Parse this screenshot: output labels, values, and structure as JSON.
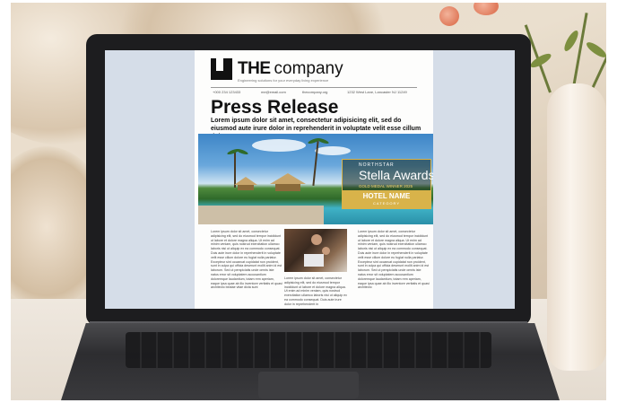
{
  "doc": {
    "logo_the": "THE",
    "logo_company": "company",
    "tagline": "Engineering solutions for your everyday living experience",
    "contact": [
      "+000 234 123433",
      "me@email.com",
      "thecompany.org",
      "1232 West Lane, Lancaster NJ 11249"
    ],
    "headline": "Press Release",
    "lead": "Lorem ipsum dolor sit amet, consectetur adipisicing elit, sed do eiusmod aute irure dolor in reprehenderit in voluptate velit esse cillum dolore eu",
    "award": {
      "top": "NORTHSTAR",
      "main": "Stella Awards",
      "sub": "GOLD MEDAL WINNER 2025",
      "band_title": "HOTEL NAME",
      "band_sub": "CATEGORY"
    },
    "col1": "Lorem ipsum dolor sit amet, consectetur adipisicing elit, sed do eiusmod tempor incididunt ut labore et dolore magna aliqua. Ut enim ad minim veniam, quis nostrud exercitation ullamco laboris nisi ut aliquip ex ea commodo consequat. Duis aute irure dolor in reprehenderit in voluptate velit esse cillum dolore eu fugiat nulla pariatur. Excepteur sint occaecat cupidatat non proident, sunt in culpa qui officia deserunt mollit anim id est laborum. Sed ut perspiciatis unde omnis iste natus error sit voluptatem accusantium doloremque laudantium, totam rem aperiam, eaque ipsa quae ab illo inventore veritatis et quasi architecto beatae vitae dicta sunt",
    "col2": "Lorem ipsum dolor sit amet, consectetur adipisicing elit, sed do eiusmod tempor incididunt ut labore et dolore magna aliqua. Ut enim ad minim veniam, quis nostrud exercitation ullamco laboris nisi ut aliquip ex ea commodo consequat. Duis aute irure dolor in reprehenderit in",
    "col3": "Lorem ipsum dolor sit amet, consectetur adipisicing elit, sed do eiusmod tempor incididunt ut labore et dolore magna aliqua. Ut enim ad minim veniam, quis nostrud exercitation ullamco laboris nisi ut aliquip ex ea commodo consequat. Duis aute irure dolor in reprehenderit in voluptate velit esse cillum dolore eu fugiat nulla pariatur. Excepteur sint occaecat cupidatat non proident, sunt in culpa qui officia deserunt mollit anim id est laborum. Sed ut perspiciatis unde omnis iste natus error sit voluptatem accusantium doloremque laudantium, totam rem aperiam, eaque ipsa quae ab illo inventore veritatis et quasi architecto"
  }
}
